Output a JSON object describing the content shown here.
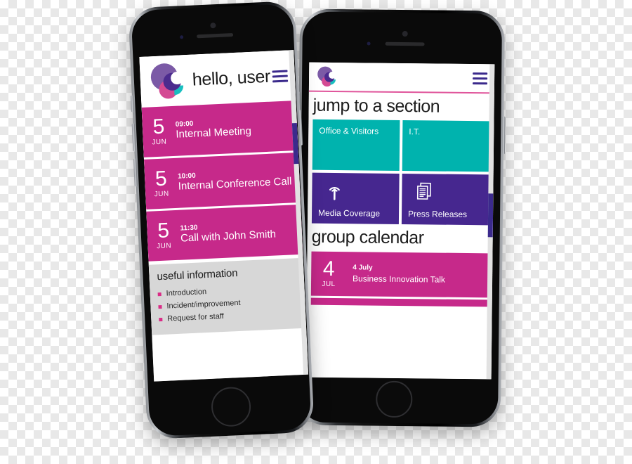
{
  "brand": {
    "logo_name": "company-logo",
    "colors": {
      "pink": "#c6298a",
      "bullet_pink": "#d92c86",
      "teal": "#00b3ae",
      "purple": "#46278f",
      "navy": "#3b2a8c",
      "grey_panel": "#d7d7d7",
      "divider_pink": "#e0559b"
    }
  },
  "front_phone": {
    "header": {
      "greeting": "hello, user",
      "menu_label": "menu"
    },
    "events": [
      {
        "day": "5",
        "month": "JUN",
        "time": "09:00",
        "title": "Internal Meeting"
      },
      {
        "day": "5",
        "month": "JUN",
        "time": "10:00",
        "title": "Internal Conference Call"
      },
      {
        "day": "5",
        "month": "JUN",
        "time": "11:30",
        "title": "Call with John Smith"
      }
    ],
    "useful_information": {
      "title": "useful information",
      "items": [
        "Introduction",
        "Incident/improvement",
        "Request for staff"
      ]
    }
  },
  "back_phone": {
    "header": {
      "menu_label": "menu"
    },
    "jump_section": {
      "title": "jump to a section",
      "tiles": [
        {
          "label": "Office & Visitors",
          "color": "teal",
          "icon": null
        },
        {
          "label": "I.T.",
          "color": "teal",
          "icon": null
        },
        {
          "label": "Media Coverage",
          "color": "purple",
          "icon": "broadcast-icon"
        },
        {
          "label": "Press Releases",
          "color": "purple",
          "icon": "documents-icon"
        }
      ]
    },
    "group_calendar": {
      "title": "group calendar",
      "events": [
        {
          "day": "4",
          "month": "JUL",
          "date": "4 July",
          "title": "Business Innovation Talk"
        }
      ]
    }
  }
}
